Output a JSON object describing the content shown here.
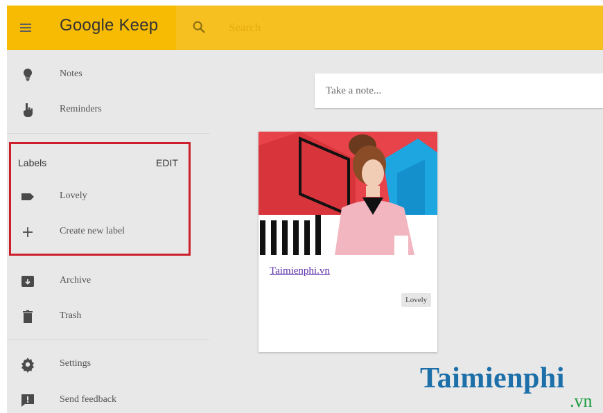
{
  "header": {
    "brand": "Google Keep",
    "search_placeholder": "Search"
  },
  "sidebar": {
    "top_items": [
      {
        "label": "Notes",
        "icon": "lightbulb-icon"
      },
      {
        "label": "Reminders",
        "icon": "reminder-hand-icon"
      }
    ],
    "labels_section": {
      "title": "Labels",
      "edit_label": "EDIT",
      "items": [
        {
          "label": "Lovely",
          "icon": "label-tag-icon"
        },
        {
          "label": "Create new label",
          "icon": "plus-icon"
        }
      ]
    },
    "bottom_items": [
      {
        "label": "Archive",
        "icon": "archive-icon"
      },
      {
        "label": "Trash",
        "icon": "trash-icon"
      }
    ],
    "footer_items": [
      {
        "label": "Settings",
        "icon": "gear-icon"
      },
      {
        "label": "Send feedback",
        "icon": "feedback-icon"
      }
    ]
  },
  "main": {
    "take_note_placeholder": "Take a note...",
    "note": {
      "link_text": "Taimienphi.vn",
      "label_chip": "Lovely"
    }
  },
  "watermark": {
    "name": "Taimienphi",
    "tld": ".vn"
  },
  "colors": {
    "header": "#f7bb03",
    "highlight_box": "#cc1f2b",
    "background": "#e8e8e8"
  }
}
